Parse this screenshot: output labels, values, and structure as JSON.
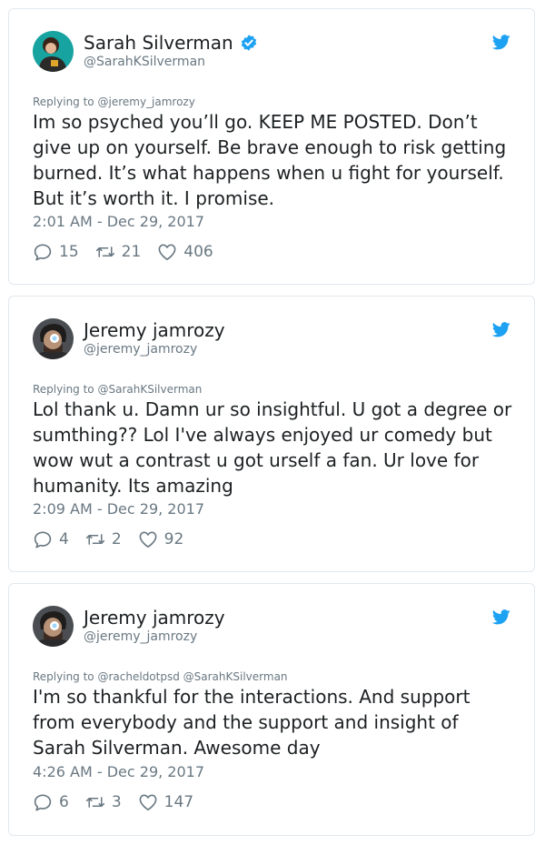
{
  "tweets": [
    {
      "name": "Sarah Silverman",
      "handle": "@SarahKSilverman",
      "verified": true,
      "reply_prefix": "Replying to",
      "reply_to": "@jeremy_jamrozy",
      "text": "Im so psyched you’ll go. KEEP ME POSTED. Don’t\ngive up on yourself. Be brave enough to risk getting\nburned. It’s what happens when u fight for yourself.\nBut it’s worth it. I promise.",
      "timestamp": "2:01 AM - Dec 29, 2017",
      "replies": "15",
      "retweets": "21",
      "likes": "406"
    },
    {
      "name": "Jeremy jamrozy",
      "handle": "@jeremy_jamrozy",
      "verified": false,
      "reply_prefix": "Replying to",
      "reply_to": "@SarahKSilverman",
      "text": "Lol thank u. Damn ur so insightful. U got a degree or\nsumthing?? Lol I've always enjoyed ur comedy but\nwow wut a contrast u got urself a fan. Ur love for\nhumanity. Its amazing",
      "timestamp": "2:09 AM - Dec 29, 2017",
      "replies": "4",
      "retweets": "2",
      "likes": "92"
    },
    {
      "name": "Jeremy jamrozy",
      "handle": "@jeremy_jamrozy",
      "verified": false,
      "reply_prefix": "Replying to",
      "reply_to": "@racheldotpsd @SarahKSilverman",
      "text": "I'm so thankful for the interactions. And support\nfrom everybody and the support and insight of\nSarah Silverman. Awesome day",
      "timestamp": "4:26 AM - Dec 29, 2017",
      "replies": "6",
      "retweets": "3",
      "likes": "147"
    }
  ],
  "colors": {
    "brand": "#1da1f2",
    "text": "#1c2022",
    "muted": "#697882",
    "border": "#e1e8ed"
  },
  "icons": [
    "avatar",
    "verified-badge-icon",
    "twitter-bird-icon",
    "reply-icon",
    "retweet-icon",
    "like-icon"
  ]
}
